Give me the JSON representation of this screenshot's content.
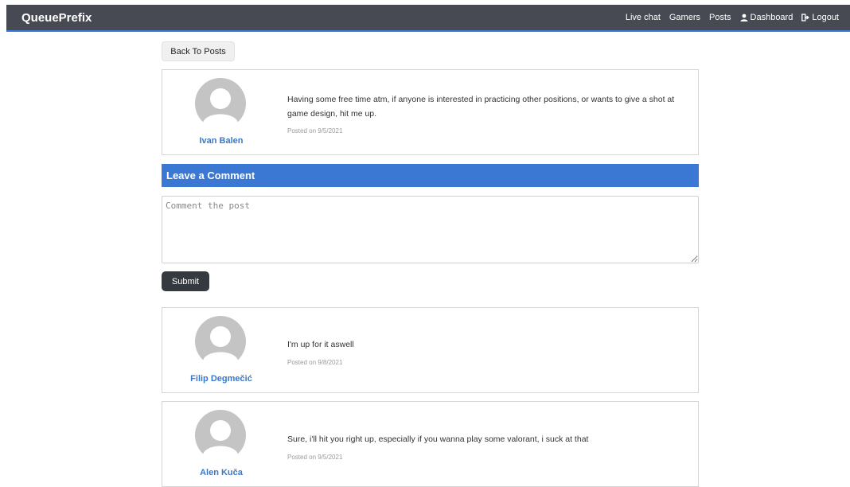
{
  "navbar": {
    "brand": "QueuePrefix",
    "links": [
      "Live chat",
      "Gamers",
      "Posts",
      "Dashboard",
      "Logout"
    ],
    "link_icons": {
      "Dashboard": "user-icon",
      "Logout": "logout-icon"
    }
  },
  "back_button": "Back To Posts",
  "post": {
    "author": "Ivan Balen",
    "text": "Having some free time atm, if anyone is interested in practicing other positions, or wants to give a shot at game design, hit me up.",
    "posted": "Posted on 9/5/2021"
  },
  "comment_form": {
    "header": "Leave a Comment",
    "placeholder": "Comment the post",
    "submit_label": "Submit"
  },
  "comments": [
    {
      "author": "Filip Degmečić",
      "text": "I'm up for it aswell",
      "posted": "Posted on 9/8/2021"
    },
    {
      "author": "Alen Kuča",
      "text": "Sure, i'll hit you right up, especially if you wanna play some valorant, i suck at that",
      "posted": "Posted on 9/5/2021"
    }
  ],
  "colors": {
    "navbar": "#474a52",
    "accent": "#3a78d4",
    "author_link": "#3a78c9",
    "submit": "#343a40"
  }
}
